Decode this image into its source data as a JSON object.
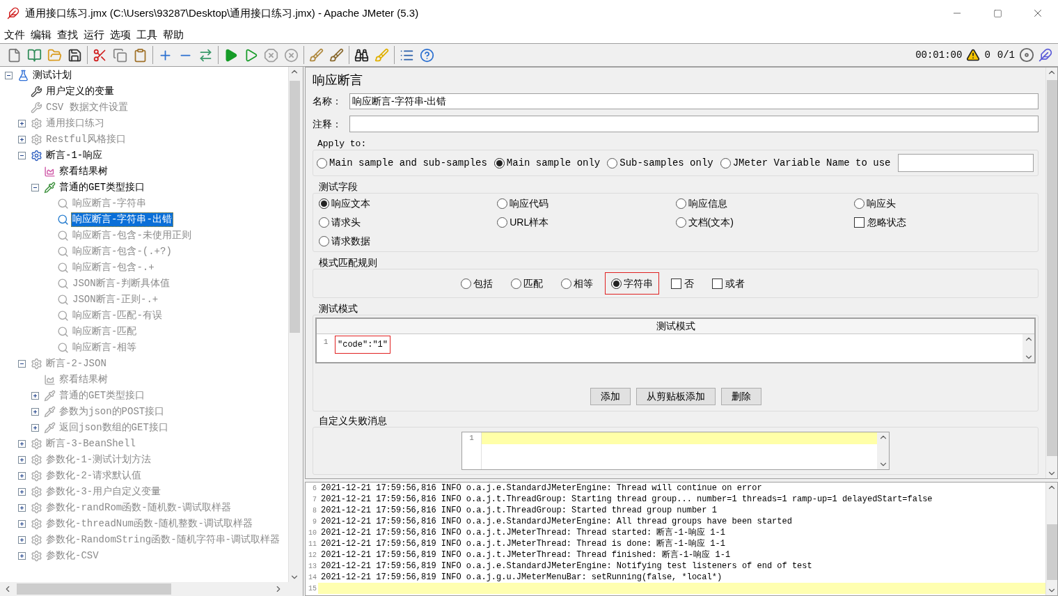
{
  "window": {
    "title": "通用接口练习.jmx (C:\\Users\\93287\\Desktop\\通用接口练习.jmx) - Apache JMeter (5.3)"
  },
  "menu": [
    "文件",
    "编辑",
    "查找",
    "运行",
    "选项",
    "工具",
    "帮助"
  ],
  "status": {
    "elapsed": "00:01:00",
    "warnings": "0",
    "threads": "0/1"
  },
  "tree": [
    {
      "label": "测试计划",
      "kind": "plan",
      "disabled": false,
      "selected": false,
      "expanded": true,
      "children": [
        {
          "label": "用户定义的变量",
          "kind": "config",
          "disabled": false,
          "selected": false
        },
        {
          "label": "CSV 数据文件设置",
          "kind": "config",
          "disabled": true,
          "selected": false
        },
        {
          "label": "通用接口练习",
          "kind": "group",
          "disabled": true,
          "selected": false,
          "expanded": false
        },
        {
          "label": "Restful风格接口",
          "kind": "group",
          "disabled": true,
          "selected": false,
          "expanded": false
        },
        {
          "label": "断言-1-响应",
          "kind": "group",
          "disabled": false,
          "selected": false,
          "expanded": true,
          "children": [
            {
              "label": "察看结果树",
              "kind": "listener",
              "disabled": false,
              "selected": false
            },
            {
              "label": "普通的GET类型接口",
              "kind": "sampler",
              "disabled": false,
              "selected": false,
              "expanded": true,
              "children": [
                {
                  "label": "响应断言-字符串",
                  "kind": "assertion",
                  "disabled": true,
                  "selected": false
                },
                {
                  "label": "响应断言-字符串-出错",
                  "kind": "assertion",
                  "disabled": false,
                  "selected": true
                },
                {
                  "label": "响应断言-包含-未使用正则",
                  "kind": "assertion",
                  "disabled": true,
                  "selected": false
                },
                {
                  "label": "响应断言-包含-(.+?)",
                  "kind": "assertion",
                  "disabled": true,
                  "selected": false
                },
                {
                  "label": "响应断言-包含-.+",
                  "kind": "assertion",
                  "disabled": true,
                  "selected": false
                },
                {
                  "label": "JSON断言-判断具体值",
                  "kind": "assertion",
                  "disabled": true,
                  "selected": false
                },
                {
                  "label": "JSON断言-正则-.+",
                  "kind": "assertion",
                  "disabled": true,
                  "selected": false
                },
                {
                  "label": "响应断言-匹配-有误",
                  "kind": "assertion",
                  "disabled": true,
                  "selected": false
                },
                {
                  "label": "响应断言-匹配",
                  "kind": "assertion",
                  "disabled": true,
                  "selected": false
                },
                {
                  "label": "响应断言-相等",
                  "kind": "assertion",
                  "disabled": true,
                  "selected": false
                }
              ]
            }
          ]
        },
        {
          "label": "断言-2-JSON",
          "kind": "group",
          "disabled": true,
          "selected": false,
          "expanded": true,
          "children": [
            {
              "label": "察看结果树",
              "kind": "listener",
              "disabled": true,
              "selected": false
            },
            {
              "label": "普通的GET类型接口",
              "kind": "sampler",
              "disabled": true,
              "selected": false,
              "expanded": false
            },
            {
              "label": "参数为json的POST接口",
              "kind": "sampler",
              "disabled": true,
              "selected": false,
              "expanded": false
            },
            {
              "label": "返回json数组的GET接口",
              "kind": "sampler",
              "disabled": true,
              "selected": false,
              "expanded": false
            }
          ]
        },
        {
          "label": "断言-3-BeanShell",
          "kind": "group",
          "disabled": true,
          "selected": false,
          "expanded": false
        },
        {
          "label": "参数化-1-测试计划方法",
          "kind": "group",
          "disabled": true,
          "selected": false,
          "expanded": false
        },
        {
          "label": "参数化-2-请求默认值",
          "kind": "group",
          "disabled": true,
          "selected": false,
          "expanded": false
        },
        {
          "label": "参数化-3-用户自定义变量",
          "kind": "group",
          "disabled": true,
          "selected": false,
          "expanded": false
        },
        {
          "label": "参数化-randRom函数-随机数-调试取样器",
          "kind": "group",
          "disabled": true,
          "selected": false,
          "expanded": false
        },
        {
          "label": "参数化-threadNum函数-随机整数-调试取样器",
          "kind": "group",
          "disabled": true,
          "selected": false,
          "expanded": false
        },
        {
          "label": "参数化-RandomString函数-随机字符串-调试取样器",
          "kind": "group",
          "disabled": true,
          "selected": false,
          "expanded": false
        },
        {
          "label": "参数化-CSV",
          "kind": "group",
          "disabled": true,
          "selected": false,
          "expanded": false
        }
      ]
    }
  ],
  "editor": {
    "title": "响应断言",
    "name_label": "名称：",
    "name_value": "响应断言-字符串-出错",
    "comment_label": "注释：",
    "apply_to": {
      "title": "Apply to:",
      "options": [
        {
          "label": "Main sample and sub-samples",
          "selected": false
        },
        {
          "label": "Main sample only",
          "selected": true
        },
        {
          "label": "Sub-samples only",
          "selected": false
        },
        {
          "label": "JMeter Variable Name to use",
          "selected": false
        }
      ]
    },
    "test_field": {
      "title": "测试字段",
      "items": [
        {
          "label": "响应文本",
          "kind": "radio",
          "selected": true
        },
        {
          "label": "响应代码",
          "kind": "radio",
          "selected": false
        },
        {
          "label": "响应信息",
          "kind": "radio",
          "selected": false
        },
        {
          "label": "响应头",
          "kind": "radio",
          "selected": false
        },
        {
          "label": "请求头",
          "kind": "radio",
          "selected": false
        },
        {
          "label": "URL样本",
          "kind": "radio",
          "selected": false
        },
        {
          "label": "文档(文本)",
          "kind": "radio",
          "selected": false
        },
        {
          "label": "忽略状态",
          "kind": "checkbox",
          "checked": false
        },
        {
          "label": "请求数据",
          "kind": "radio",
          "selected": false
        }
      ]
    },
    "match_rules": {
      "title": "模式匹配规则",
      "items": [
        {
          "label": "包括",
          "kind": "radio",
          "selected": false,
          "highlighted": false
        },
        {
          "label": "匹配",
          "kind": "radio",
          "selected": false,
          "highlighted": false
        },
        {
          "label": "相等",
          "kind": "radio",
          "selected": false,
          "highlighted": false
        },
        {
          "label": "字符串",
          "kind": "radio",
          "selected": true,
          "highlighted": true
        },
        {
          "label": "否",
          "kind": "checkbox",
          "checked": false,
          "highlighted": false
        },
        {
          "label": "或者",
          "kind": "checkbox",
          "checked": false,
          "highlighted": false
        }
      ]
    },
    "patterns": {
      "title": "测试模式",
      "column": "测试模式",
      "rows": [
        {
          "number": "1",
          "text": "\"code\":\"1\"",
          "highlighted": true
        }
      ],
      "buttons": [
        "添加",
        "从剪贴板添加",
        "删除"
      ]
    },
    "failure_message": {
      "title": "自定义失败消息",
      "lines": [
        {
          "number": "1",
          "current": true
        }
      ]
    }
  },
  "log": {
    "lines": [
      {
        "number": "6",
        "text": "2021-12-21 17:59:56,816 INFO o.a.j.e.StandardJMeterEngine: Thread will continue on error",
        "current": false
      },
      {
        "number": "7",
        "text": "2021-12-21 17:59:56,816 INFO o.a.j.t.ThreadGroup: Starting thread group... number=1 threads=1 ramp-up=1 delayedStart=false",
        "current": false
      },
      {
        "number": "8",
        "text": "2021-12-21 17:59:56,816 INFO o.a.j.t.ThreadGroup: Started thread group number 1",
        "current": false
      },
      {
        "number": "9",
        "text": "2021-12-21 17:59:56,816 INFO o.a.j.e.StandardJMeterEngine: All thread groups have been started",
        "current": false
      },
      {
        "number": "10",
        "text": "2021-12-21 17:59:56,816 INFO o.a.j.t.JMeterThread: Thread started: 断言-1-响应 1-1",
        "current": false
      },
      {
        "number": "11",
        "text": "2021-12-21 17:59:56,819 INFO o.a.j.t.JMeterThread: Thread is done: 断言-1-响应 1-1",
        "current": false
      },
      {
        "number": "12",
        "text": "2021-12-21 17:59:56,819 INFO o.a.j.t.JMeterThread: Thread finished: 断言-1-响应 1-1",
        "current": false
      },
      {
        "number": "13",
        "text": "2021-12-21 17:59:56,819 INFO o.a.j.e.StandardJMeterEngine: Notifying test listeners of end of test",
        "current": false
      },
      {
        "number": "14",
        "text": "2021-12-21 17:59:56,819 INFO o.a.j.g.u.JMeterMenuBar: setRunning(false, *local*)",
        "current": false
      },
      {
        "number": "15",
        "current": true
      }
    ]
  }
}
